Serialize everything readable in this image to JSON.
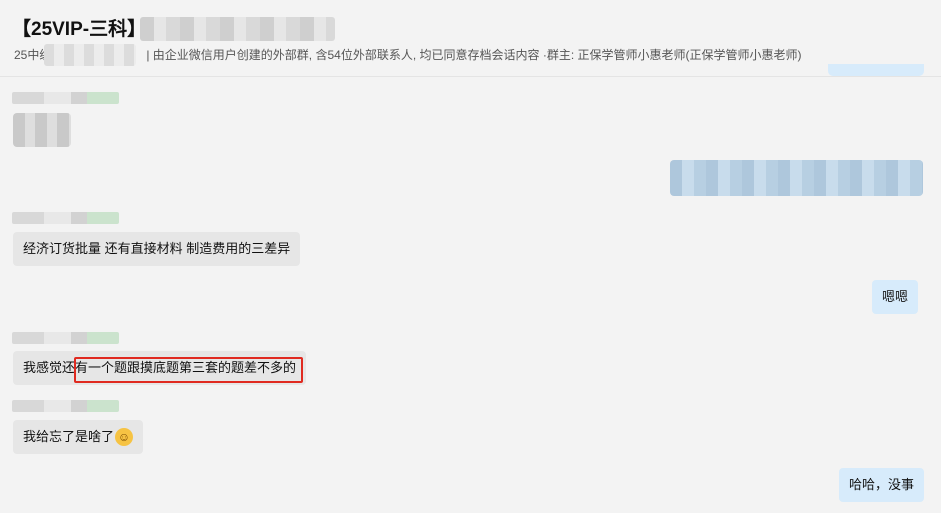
{
  "header": {
    "title": "【25VIP-三科】",
    "subtitle_prefix": "25中级",
    "subtitle_rest": "| 由企业微信用户创建的外部群, 含54位外部联系人, 均已同意存档会话内容 ·群主: 正保学管师小惠老师(正保学管师小惠老师)"
  },
  "messages": [
    {
      "id": "m1",
      "direction": "incoming",
      "text": ""
    },
    {
      "id": "m2",
      "direction": "outgoing",
      "text": ""
    },
    {
      "id": "m3",
      "direction": "incoming",
      "text": "经济订货批量 还有直接材料 制造费用的三差异"
    },
    {
      "id": "m4",
      "direction": "outgoing",
      "text": "嗯嗯"
    },
    {
      "id": "m5",
      "direction": "incoming",
      "text": "我感觉还有一个题跟摸底题第三套的题差不多的"
    },
    {
      "id": "m6",
      "direction": "incoming",
      "text": "我给忘了是啥了"
    },
    {
      "id": "m7",
      "direction": "outgoing",
      "text": "哈哈，没事"
    }
  ],
  "icons": {
    "emoji": "laughing-tears-emoji"
  },
  "colors": {
    "incoming_bubble": "#e6e6e6",
    "outgoing_bubble": "#d7ebfb",
    "highlight": "#e02a20"
  }
}
